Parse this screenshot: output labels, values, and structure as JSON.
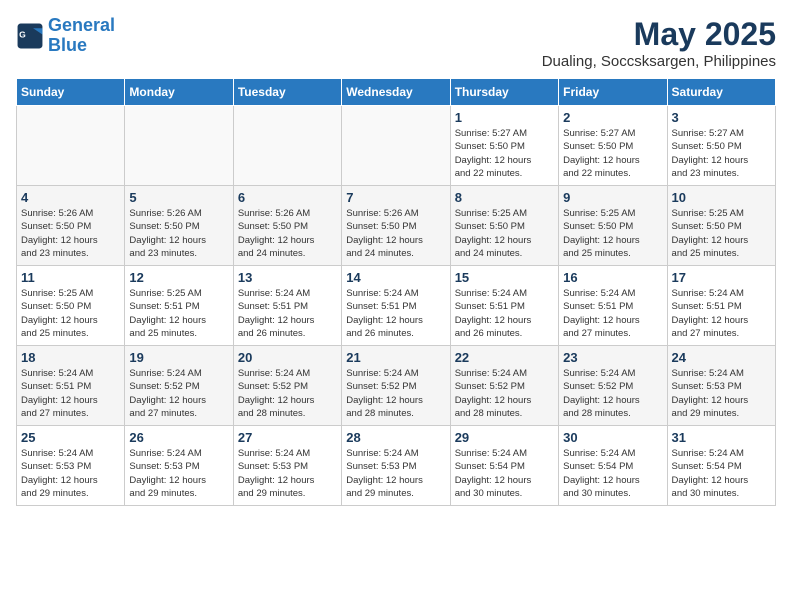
{
  "logo": {
    "line1": "General",
    "line2": "Blue"
  },
  "title": "May 2025",
  "subtitle": "Dualing, Soccsksargen, Philippines",
  "days_of_week": [
    "Sunday",
    "Monday",
    "Tuesday",
    "Wednesday",
    "Thursday",
    "Friday",
    "Saturday"
  ],
  "weeks": [
    [
      {
        "day": "",
        "info": ""
      },
      {
        "day": "",
        "info": ""
      },
      {
        "day": "",
        "info": ""
      },
      {
        "day": "",
        "info": ""
      },
      {
        "day": "1",
        "info": "Sunrise: 5:27 AM\nSunset: 5:50 PM\nDaylight: 12 hours\nand 22 minutes."
      },
      {
        "day": "2",
        "info": "Sunrise: 5:27 AM\nSunset: 5:50 PM\nDaylight: 12 hours\nand 22 minutes."
      },
      {
        "day": "3",
        "info": "Sunrise: 5:27 AM\nSunset: 5:50 PM\nDaylight: 12 hours\nand 23 minutes."
      }
    ],
    [
      {
        "day": "4",
        "info": "Sunrise: 5:26 AM\nSunset: 5:50 PM\nDaylight: 12 hours\nand 23 minutes."
      },
      {
        "day": "5",
        "info": "Sunrise: 5:26 AM\nSunset: 5:50 PM\nDaylight: 12 hours\nand 23 minutes."
      },
      {
        "day": "6",
        "info": "Sunrise: 5:26 AM\nSunset: 5:50 PM\nDaylight: 12 hours\nand 24 minutes."
      },
      {
        "day": "7",
        "info": "Sunrise: 5:26 AM\nSunset: 5:50 PM\nDaylight: 12 hours\nand 24 minutes."
      },
      {
        "day": "8",
        "info": "Sunrise: 5:25 AM\nSunset: 5:50 PM\nDaylight: 12 hours\nand 24 minutes."
      },
      {
        "day": "9",
        "info": "Sunrise: 5:25 AM\nSunset: 5:50 PM\nDaylight: 12 hours\nand 25 minutes."
      },
      {
        "day": "10",
        "info": "Sunrise: 5:25 AM\nSunset: 5:50 PM\nDaylight: 12 hours\nand 25 minutes."
      }
    ],
    [
      {
        "day": "11",
        "info": "Sunrise: 5:25 AM\nSunset: 5:50 PM\nDaylight: 12 hours\nand 25 minutes."
      },
      {
        "day": "12",
        "info": "Sunrise: 5:25 AM\nSunset: 5:51 PM\nDaylight: 12 hours\nand 25 minutes."
      },
      {
        "day": "13",
        "info": "Sunrise: 5:24 AM\nSunset: 5:51 PM\nDaylight: 12 hours\nand 26 minutes."
      },
      {
        "day": "14",
        "info": "Sunrise: 5:24 AM\nSunset: 5:51 PM\nDaylight: 12 hours\nand 26 minutes."
      },
      {
        "day": "15",
        "info": "Sunrise: 5:24 AM\nSunset: 5:51 PM\nDaylight: 12 hours\nand 26 minutes."
      },
      {
        "day": "16",
        "info": "Sunrise: 5:24 AM\nSunset: 5:51 PM\nDaylight: 12 hours\nand 27 minutes."
      },
      {
        "day": "17",
        "info": "Sunrise: 5:24 AM\nSunset: 5:51 PM\nDaylight: 12 hours\nand 27 minutes."
      }
    ],
    [
      {
        "day": "18",
        "info": "Sunrise: 5:24 AM\nSunset: 5:51 PM\nDaylight: 12 hours\nand 27 minutes."
      },
      {
        "day": "19",
        "info": "Sunrise: 5:24 AM\nSunset: 5:52 PM\nDaylight: 12 hours\nand 27 minutes."
      },
      {
        "day": "20",
        "info": "Sunrise: 5:24 AM\nSunset: 5:52 PM\nDaylight: 12 hours\nand 28 minutes."
      },
      {
        "day": "21",
        "info": "Sunrise: 5:24 AM\nSunset: 5:52 PM\nDaylight: 12 hours\nand 28 minutes."
      },
      {
        "day": "22",
        "info": "Sunrise: 5:24 AM\nSunset: 5:52 PM\nDaylight: 12 hours\nand 28 minutes."
      },
      {
        "day": "23",
        "info": "Sunrise: 5:24 AM\nSunset: 5:52 PM\nDaylight: 12 hours\nand 28 minutes."
      },
      {
        "day": "24",
        "info": "Sunrise: 5:24 AM\nSunset: 5:53 PM\nDaylight: 12 hours\nand 29 minutes."
      }
    ],
    [
      {
        "day": "25",
        "info": "Sunrise: 5:24 AM\nSunset: 5:53 PM\nDaylight: 12 hours\nand 29 minutes."
      },
      {
        "day": "26",
        "info": "Sunrise: 5:24 AM\nSunset: 5:53 PM\nDaylight: 12 hours\nand 29 minutes."
      },
      {
        "day": "27",
        "info": "Sunrise: 5:24 AM\nSunset: 5:53 PM\nDaylight: 12 hours\nand 29 minutes."
      },
      {
        "day": "28",
        "info": "Sunrise: 5:24 AM\nSunset: 5:53 PM\nDaylight: 12 hours\nand 29 minutes."
      },
      {
        "day": "29",
        "info": "Sunrise: 5:24 AM\nSunset: 5:54 PM\nDaylight: 12 hours\nand 30 minutes."
      },
      {
        "day": "30",
        "info": "Sunrise: 5:24 AM\nSunset: 5:54 PM\nDaylight: 12 hours\nand 30 minutes."
      },
      {
        "day": "31",
        "info": "Sunrise: 5:24 AM\nSunset: 5:54 PM\nDaylight: 12 hours\nand 30 minutes."
      }
    ]
  ]
}
